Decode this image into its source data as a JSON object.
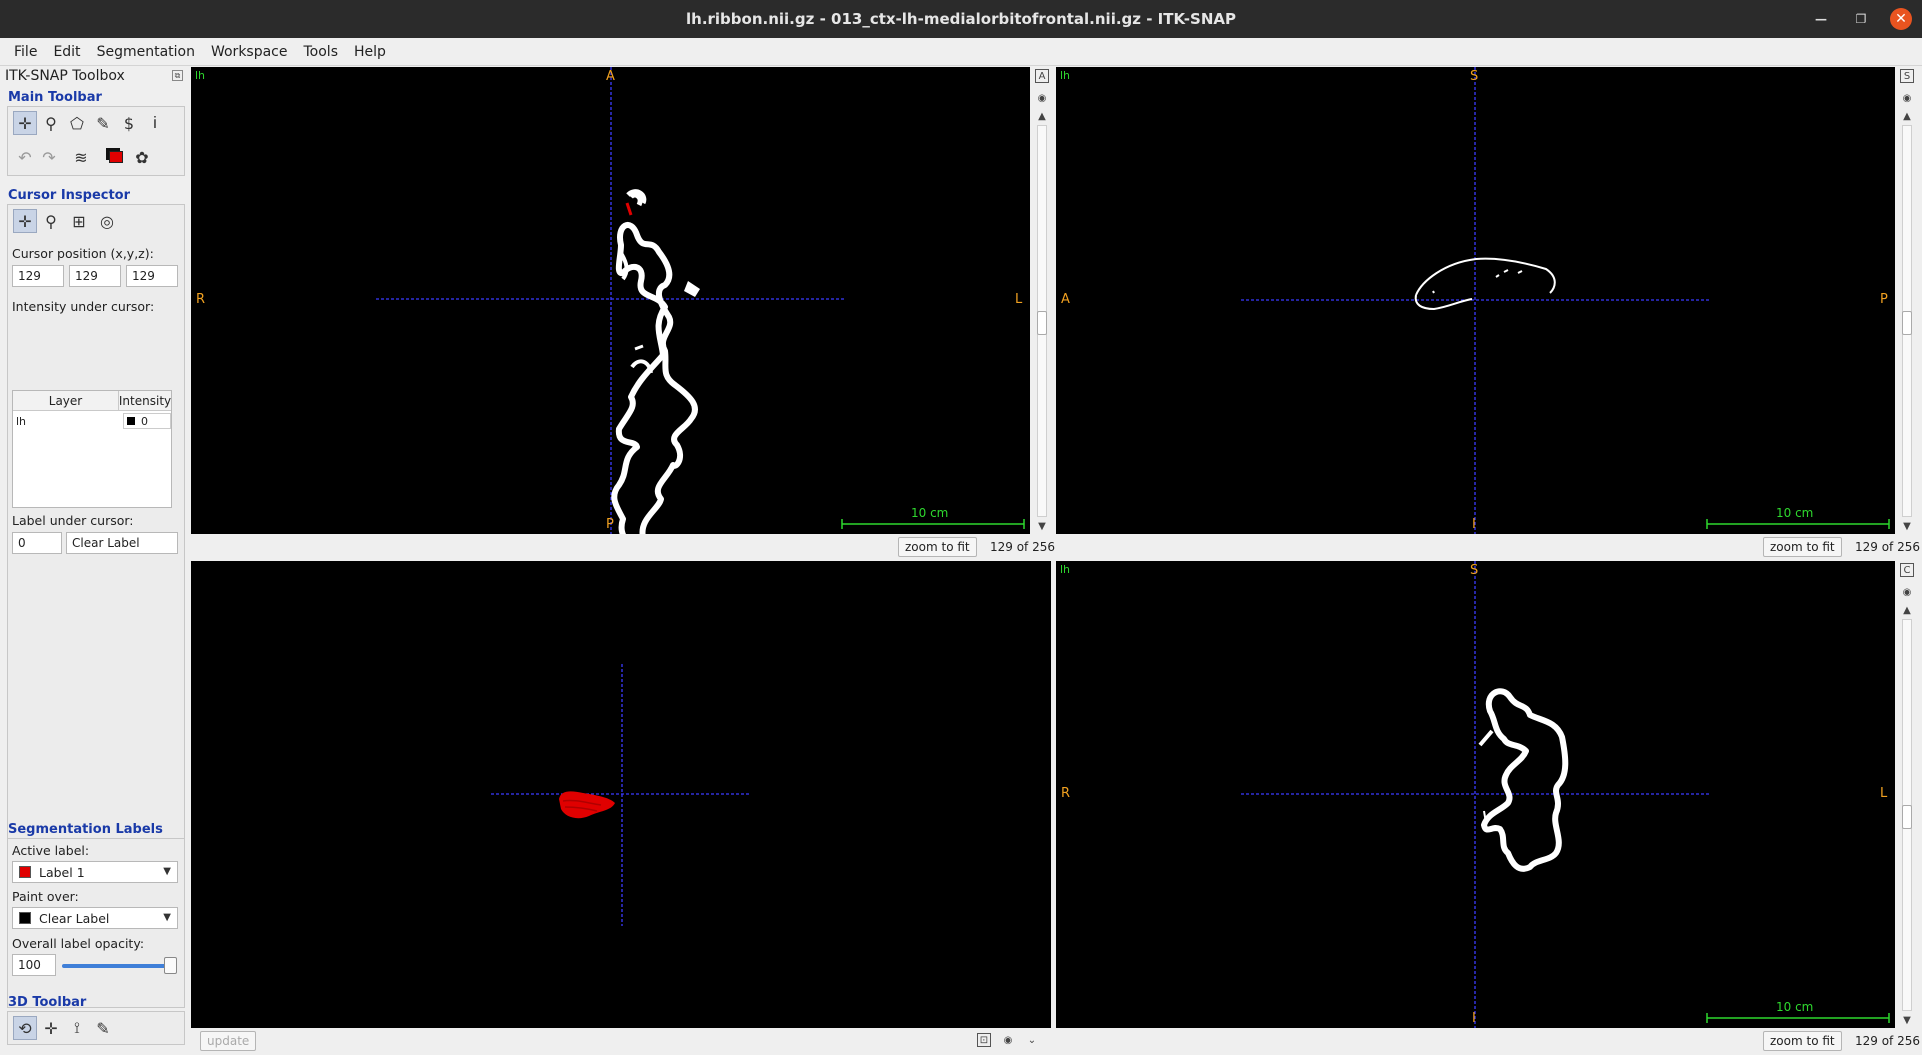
{
  "window": {
    "title": "lh.ribbon.nii.gz - 013_ctx-lh-medialorbitofrontal.nii.gz - ITK-SNAP"
  },
  "menu": [
    "File",
    "Edit",
    "Segmentation",
    "Workspace",
    "Tools",
    "Help"
  ],
  "toolbox": {
    "title": "ITK-SNAP Toolbox",
    "main_toolbar": {
      "title": "Main Toolbar",
      "tools": [
        "crosshair-tool-icon",
        "zoom-tool-icon",
        "polygon-tool-icon",
        "paintbrush-tool-icon",
        "snake-tool-icon",
        "annotation-tool-icon"
      ],
      "actions": [
        "undo-icon",
        "redo-icon",
        "layers-icon",
        "label-color-icon",
        "palette-icon"
      ]
    },
    "cursor_inspector": {
      "title": "Cursor Inspector",
      "position_label": "Cursor position (x,y,z):",
      "x": "129",
      "y": "129",
      "z": "129",
      "intensity_label": "Intensity under cursor:",
      "col_layer": "Layer",
      "col_intensity": "Intensity",
      "rows": [
        {
          "layer": "lh",
          "intensity": "0"
        }
      ],
      "label_under_cursor": "Label under cursor:",
      "label_id": "0",
      "label_name": "Clear Label"
    },
    "segmentation_labels": {
      "title": "Segmentation Labels",
      "active_label_caption": "Active label:",
      "active_label": "Label 1",
      "active_label_color": "#e00000",
      "paint_over_caption": "Paint over:",
      "paint_over": "Clear Label",
      "paint_over_color": "#000000",
      "opacity_caption": "Overall label opacity:",
      "opacity": "100",
      "opacity_fraction": 1.0
    },
    "toolbar_3d": {
      "title": "3D Toolbar"
    }
  },
  "views": {
    "axial": {
      "layer": "lh",
      "top": "A",
      "bottom": "P",
      "left": "R",
      "right": "L",
      "scale": "10 cm",
      "zoom_btn": "zoom to fit",
      "slice": "129 of 256"
    },
    "sagittal": {
      "layer": "lh",
      "top": "S",
      "bottom": "I",
      "left": "A",
      "right": "P",
      "scale": "10 cm",
      "zoom_btn": "zoom to fit",
      "slice": "129 of 256"
    },
    "three_d": {
      "update_btn": "update"
    },
    "coronal": {
      "layer": "lh",
      "top": "S",
      "bottom": "I",
      "left": "R",
      "right": "L",
      "scale": "10 cm",
      "zoom_btn": "zoom to fit",
      "slice": "129 of 256"
    }
  },
  "colors": {
    "crosshair": "#3b3bff",
    "orientation": "#f0a020",
    "scale": "#2ed82e",
    "segmentation": "#e00000"
  }
}
